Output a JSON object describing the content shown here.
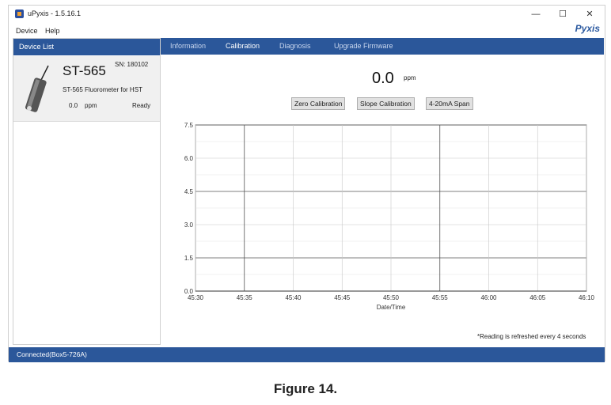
{
  "window": {
    "title": "uPyxis - 1.5.16.1",
    "min": "—",
    "max": "☐",
    "close": "✕"
  },
  "menu": {
    "device": "Device",
    "help": "Help"
  },
  "brand": "Pyxis",
  "sidebar": {
    "header": "Device List",
    "device": {
      "name": "ST-565",
      "sn": "SN: 180102",
      "description": "ST-565 Fluorometer for HST",
      "value": "0.0",
      "unit": "ppm",
      "status": "Ready"
    }
  },
  "tabs": [
    {
      "label": "Information"
    },
    {
      "label": "Calibration"
    },
    {
      "label": "Diagnosis"
    },
    {
      "label": "Upgrade Firmware"
    }
  ],
  "reading": {
    "value": "0.0",
    "unit": "ppm"
  },
  "buttons": {
    "zero": "Zero Calibration",
    "slope": "Slope Calibration",
    "span": "4-20mA Span"
  },
  "chart_data": {
    "type": "line",
    "xlabel": "Date/Time",
    "ylabel": "",
    "x_ticks": [
      "45:30",
      "45:35",
      "45:40",
      "45:45",
      "45:50",
      "45:55",
      "46:00",
      "46:05",
      "46:10"
    ],
    "y_ticks": [
      "0.0",
      "1.5",
      "3.0",
      "4.5",
      "6.0",
      "7.5"
    ],
    "ylim": [
      0,
      7.5
    ],
    "grid": true,
    "series": []
  },
  "note": "*Reading is refreshed every 4 seconds",
  "status": "Connected(Box5-726A)",
  "caption": "Figure 14."
}
